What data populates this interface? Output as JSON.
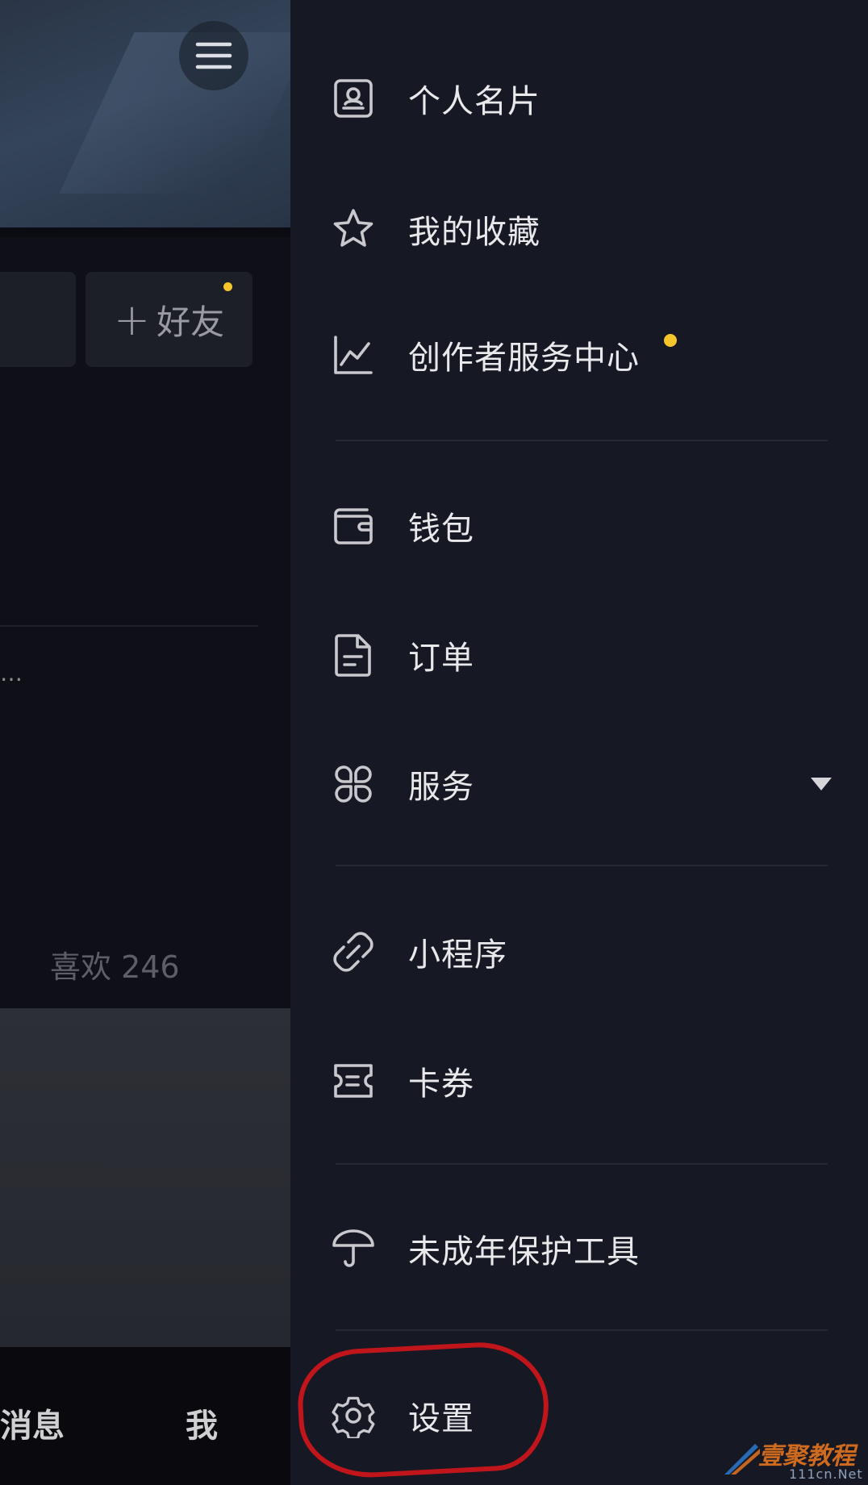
{
  "background": {
    "add_friend_plus": "+",
    "add_friend_label": "好友",
    "ellipsis": "…",
    "likes_label": "喜欢 246",
    "nav_messages": "消息",
    "nav_me": "我"
  },
  "drawer": {
    "items": [
      {
        "label": "个人名片",
        "icon": "id-card-icon"
      },
      {
        "label": "我的收藏",
        "icon": "star-icon"
      },
      {
        "label": "创作者服务中心",
        "icon": "chart-icon",
        "badge": true
      },
      {
        "label": "钱包",
        "icon": "wallet-icon"
      },
      {
        "label": "订单",
        "icon": "document-icon"
      },
      {
        "label": "服务",
        "icon": "grid-icon",
        "expandable": true
      },
      {
        "label": "小程序",
        "icon": "link-icon"
      },
      {
        "label": "卡券",
        "icon": "ticket-icon"
      },
      {
        "label": "未成年保护工具",
        "icon": "umbrella-icon"
      },
      {
        "label": "设置",
        "icon": "gear-icon"
      }
    ]
  },
  "colors": {
    "drawer_bg": "#161823",
    "badge": "#f5c52c",
    "annotation": "#c0161b"
  },
  "watermark": {
    "title": "壹聚教程",
    "url": "111cn.Net"
  }
}
